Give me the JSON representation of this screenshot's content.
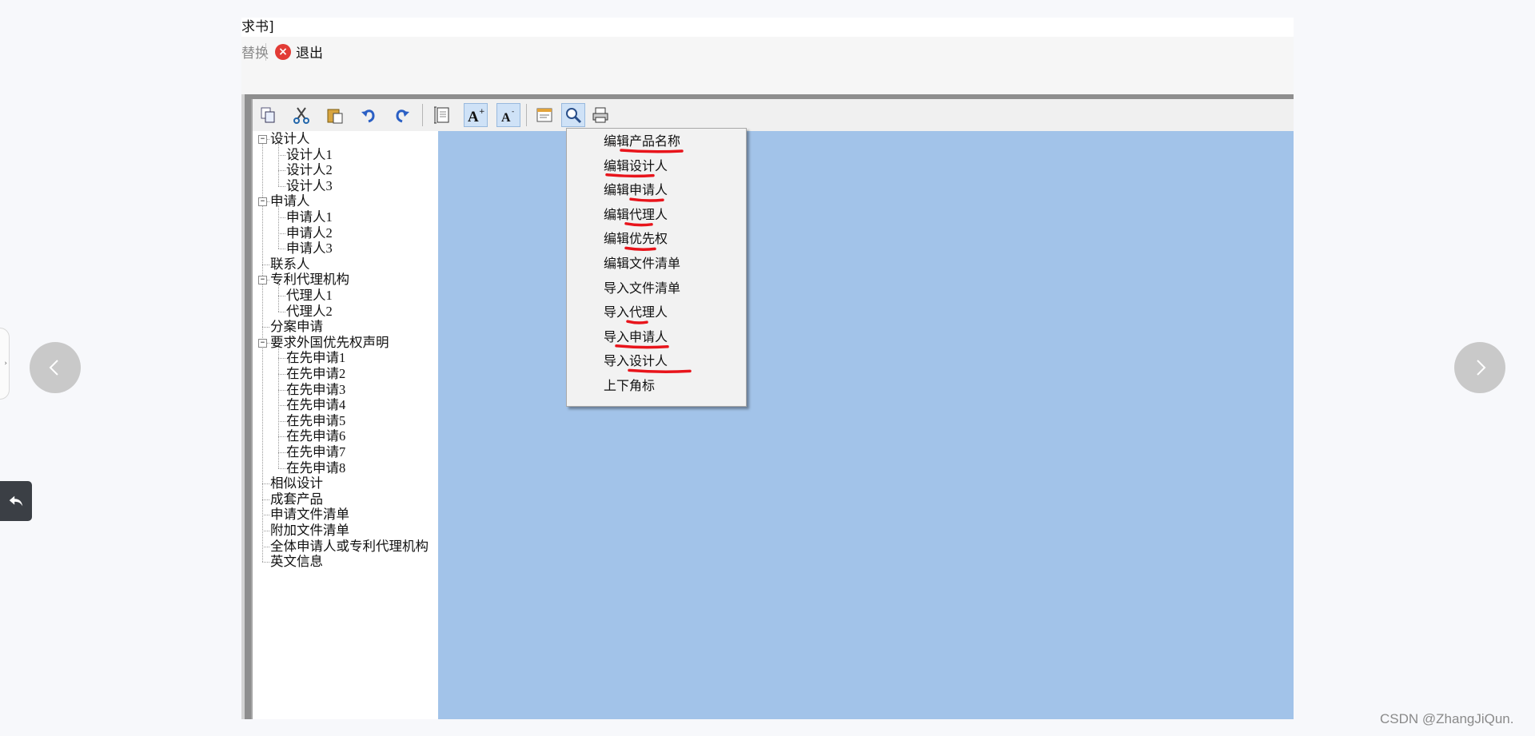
{
  "window": {
    "title_fragment": "求书]"
  },
  "menubar": {
    "faded_item": "替换",
    "exit_label": "退出"
  },
  "toolbar": {
    "buttons": [
      "copy-icon",
      "cut-icon",
      "paste-icon",
      "undo-icon",
      "redo-icon",
      "page-setup-icon",
      "font-increase-icon",
      "font-decrease-icon",
      "form-icon",
      "zoom-icon",
      "print-icon"
    ]
  },
  "tree": {
    "items": [
      {
        "label": "设计人",
        "level": 0,
        "expandable": true
      },
      {
        "label": "设计人1",
        "level": 1
      },
      {
        "label": "设计人2",
        "level": 1
      },
      {
        "label": "设计人3",
        "level": 1
      },
      {
        "label": "申请人",
        "level": 0,
        "expandable": true
      },
      {
        "label": "申请人1",
        "level": 1
      },
      {
        "label": "申请人2",
        "level": 1
      },
      {
        "label": "申请人3",
        "level": 1
      },
      {
        "label": "联系人",
        "level": 0
      },
      {
        "label": "专利代理机构",
        "level": 0,
        "expandable": true
      },
      {
        "label": "代理人1",
        "level": 1
      },
      {
        "label": "代理人2",
        "level": 1
      },
      {
        "label": "分案申请",
        "level": 0
      },
      {
        "label": "要求外国优先权声明",
        "level": 0,
        "expandable": true
      },
      {
        "label": "在先申请1",
        "level": 1
      },
      {
        "label": "在先申请2",
        "level": 1
      },
      {
        "label": "在先申请3",
        "level": 1
      },
      {
        "label": "在先申请4",
        "level": 1
      },
      {
        "label": "在先申请5",
        "level": 1
      },
      {
        "label": "在先申请6",
        "level": 1
      },
      {
        "label": "在先申请7",
        "level": 1
      },
      {
        "label": "在先申请8",
        "level": 1
      },
      {
        "label": "相似设计",
        "level": 0
      },
      {
        "label": "成套产品",
        "level": 0
      },
      {
        "label": "申请文件清单",
        "level": 0
      },
      {
        "label": "附加文件清单",
        "level": 0
      },
      {
        "label": "全体申请人或专利代理机构",
        "level": 0
      },
      {
        "label": "英文信息",
        "level": 0
      }
    ]
  },
  "context_menu": {
    "items": [
      "编辑产品名称",
      "编辑设计人",
      "编辑申请人",
      "编辑代理人",
      "编辑优先权",
      "编辑文件清单",
      "导入文件清单",
      "导入代理人",
      "导入申请人",
      "导入设计人",
      "上下角标"
    ]
  },
  "colors": {
    "canvas": "#a2c3e9",
    "annotation": "#e8141b",
    "exit": "#e23b35"
  },
  "watermark": "CSDN @ZhangJiQun.",
  "icons": {
    "prev": "chevron-left-icon",
    "next": "chevron-right-icon",
    "back": "reply-arrow-icon"
  }
}
